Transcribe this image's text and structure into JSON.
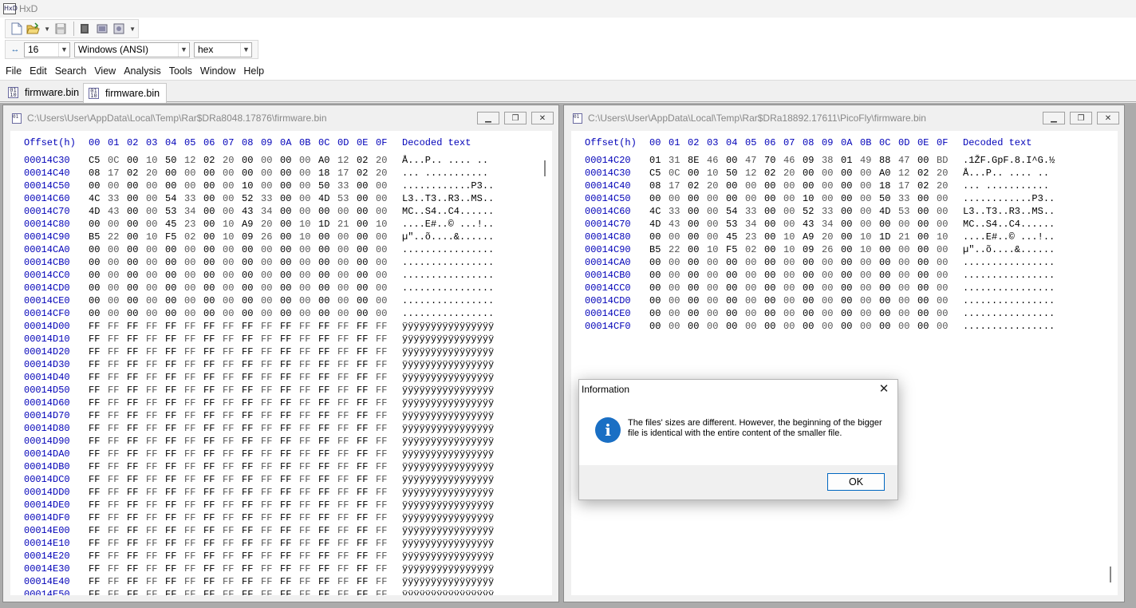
{
  "window": {
    "title": "HxD"
  },
  "toolbar": {
    "bytes_per_row": "16",
    "charset": "Windows (ANSI)",
    "offset_base": "hex"
  },
  "menu": [
    "File",
    "Edit",
    "Search",
    "View",
    "Analysis",
    "Tools",
    "Window",
    "Help"
  ],
  "tabs": [
    {
      "label": "firmware.bin",
      "active": false
    },
    {
      "label": "firmware.bin",
      "active": true
    }
  ],
  "hex_header": {
    "offset_label": "Offset(h)",
    "columns": [
      "00",
      "01",
      "02",
      "03",
      "04",
      "05",
      "06",
      "07",
      "08",
      "09",
      "0A",
      "0B",
      "0C",
      "0D",
      "0E",
      "0F"
    ],
    "text_label": "Decoded text"
  },
  "left_pane": {
    "path": "C:\\Users\\User\\AppData\\Local\\Temp\\Rar$DRa8048.17876\\firmware.bin",
    "rows": [
      {
        "off": "00014C30",
        "hex": "C5 0C 00 10 50 12 02 20 00 00 00 00 A0 12 02 20",
        "text": "Å...P.. .... .."
      },
      {
        "off": "00014C40",
        "hex": "08 17 02 20 00 00 00 00 00 00 00 00 18 17 02 20",
        "text": "... ........... "
      },
      {
        "off": "00014C50",
        "hex": "00 00 00 00 00 00 00 00 10 00 00 00 50 33 00 00",
        "text": "............P3.."
      },
      {
        "off": "00014C60",
        "hex": "4C 33 00 00 54 33 00 00 52 33 00 00 4D 53 00 00",
        "text": "L3..T3..R3..MS.."
      },
      {
        "off": "00014C70",
        "hex": "4D 43 00 00 53 34 00 00 43 34 00 00 00 00 00 00",
        "text": "MC..S4..C4......"
      },
      {
        "off": "00014C80",
        "hex": "00 00 00 00 45 23 00 10 A9 20 00 10 1D 21 00 10",
        "text": "....E#..© ...!.."
      },
      {
        "off": "00014C90",
        "hex": "B5 22 00 10 F5 02 00 10 09 26 00 10 00 00 00 00",
        "text": "µ\"..õ....&......"
      },
      {
        "off": "00014CA0",
        "hex": "00 00 00 00 00 00 00 00 00 00 00 00 00 00 00 00",
        "text": "................"
      },
      {
        "off": "00014CB0",
        "hex": "00 00 00 00 00 00 00 00 00 00 00 00 00 00 00 00",
        "text": "................"
      },
      {
        "off": "00014CC0",
        "hex": "00 00 00 00 00 00 00 00 00 00 00 00 00 00 00 00",
        "text": "................"
      },
      {
        "off": "00014CD0",
        "hex": "00 00 00 00 00 00 00 00 00 00 00 00 00 00 00 00",
        "text": "................"
      },
      {
        "off": "00014CE0",
        "hex": "00 00 00 00 00 00 00 00 00 00 00 00 00 00 00 00",
        "text": "................"
      },
      {
        "off": "00014CF0",
        "hex": "00 00 00 00 00 00 00 00 00 00 00 00 00 00 00 00",
        "text": "................"
      },
      {
        "off": "00014D00",
        "hex": "FF FF FF FF FF FF FF FF FF FF FF FF FF FF FF FF",
        "text": "ÿÿÿÿÿÿÿÿÿÿÿÿÿÿÿÿ"
      },
      {
        "off": "00014D10",
        "hex": "FF FF FF FF FF FF FF FF FF FF FF FF FF FF FF FF",
        "text": "ÿÿÿÿÿÿÿÿÿÿÿÿÿÿÿÿ"
      },
      {
        "off": "00014D20",
        "hex": "FF FF FF FF FF FF FF FF FF FF FF FF FF FF FF FF",
        "text": "ÿÿÿÿÿÿÿÿÿÿÿÿÿÿÿÿ"
      },
      {
        "off": "00014D30",
        "hex": "FF FF FF FF FF FF FF FF FF FF FF FF FF FF FF FF",
        "text": "ÿÿÿÿÿÿÿÿÿÿÿÿÿÿÿÿ"
      },
      {
        "off": "00014D40",
        "hex": "FF FF FF FF FF FF FF FF FF FF FF FF FF FF FF FF",
        "text": "ÿÿÿÿÿÿÿÿÿÿÿÿÿÿÿÿ"
      },
      {
        "off": "00014D50",
        "hex": "FF FF FF FF FF FF FF FF FF FF FF FF FF FF FF FF",
        "text": "ÿÿÿÿÿÿÿÿÿÿÿÿÿÿÿÿ"
      },
      {
        "off": "00014D60",
        "hex": "FF FF FF FF FF FF FF FF FF FF FF FF FF FF FF FF",
        "text": "ÿÿÿÿÿÿÿÿÿÿÿÿÿÿÿÿ"
      },
      {
        "off": "00014D70",
        "hex": "FF FF FF FF FF FF FF FF FF FF FF FF FF FF FF FF",
        "text": "ÿÿÿÿÿÿÿÿÿÿÿÿÿÿÿÿ"
      },
      {
        "off": "00014D80",
        "hex": "FF FF FF FF FF FF FF FF FF FF FF FF FF FF FF FF",
        "text": "ÿÿÿÿÿÿÿÿÿÿÿÿÿÿÿÿ"
      },
      {
        "off": "00014D90",
        "hex": "FF FF FF FF FF FF FF FF FF FF FF FF FF FF FF FF",
        "text": "ÿÿÿÿÿÿÿÿÿÿÿÿÿÿÿÿ"
      },
      {
        "off": "00014DA0",
        "hex": "FF FF FF FF FF FF FF FF FF FF FF FF FF FF FF FF",
        "text": "ÿÿÿÿÿÿÿÿÿÿÿÿÿÿÿÿ"
      },
      {
        "off": "00014DB0",
        "hex": "FF FF FF FF FF FF FF FF FF FF FF FF FF FF FF FF",
        "text": "ÿÿÿÿÿÿÿÿÿÿÿÿÿÿÿÿ"
      },
      {
        "off": "00014DC0",
        "hex": "FF FF FF FF FF FF FF FF FF FF FF FF FF FF FF FF",
        "text": "ÿÿÿÿÿÿÿÿÿÿÿÿÿÿÿÿ"
      },
      {
        "off": "00014DD0",
        "hex": "FF FF FF FF FF FF FF FF FF FF FF FF FF FF FF FF",
        "text": "ÿÿÿÿÿÿÿÿÿÿÿÿÿÿÿÿ"
      },
      {
        "off": "00014DE0",
        "hex": "FF FF FF FF FF FF FF FF FF FF FF FF FF FF FF FF",
        "text": "ÿÿÿÿÿÿÿÿÿÿÿÿÿÿÿÿ"
      },
      {
        "off": "00014DF0",
        "hex": "FF FF FF FF FF FF FF FF FF FF FF FF FF FF FF FF",
        "text": "ÿÿÿÿÿÿÿÿÿÿÿÿÿÿÿÿ"
      },
      {
        "off": "00014E00",
        "hex": "FF FF FF FF FF FF FF FF FF FF FF FF FF FF FF FF",
        "text": "ÿÿÿÿÿÿÿÿÿÿÿÿÿÿÿÿ"
      },
      {
        "off": "00014E10",
        "hex": "FF FF FF FF FF FF FF FF FF FF FF FF FF FF FF FF",
        "text": "ÿÿÿÿÿÿÿÿÿÿÿÿÿÿÿÿ"
      },
      {
        "off": "00014E20",
        "hex": "FF FF FF FF FF FF FF FF FF FF FF FF FF FF FF FF",
        "text": "ÿÿÿÿÿÿÿÿÿÿÿÿÿÿÿÿ"
      },
      {
        "off": "00014E30",
        "hex": "FF FF FF FF FF FF FF FF FF FF FF FF FF FF FF FF",
        "text": "ÿÿÿÿÿÿÿÿÿÿÿÿÿÿÿÿ"
      },
      {
        "off": "00014E40",
        "hex": "FF FF FF FF FF FF FF FF FF FF FF FF FF FF FF FF",
        "text": "ÿÿÿÿÿÿÿÿÿÿÿÿÿÿÿÿ"
      },
      {
        "off": "00014E50",
        "hex": "FF FF FF FF FF FF FF FF FF FF FF FF FF FF FF FF",
        "text": "ÿÿÿÿÿÿÿÿÿÿÿÿÿÿÿÿ"
      }
    ]
  },
  "right_pane": {
    "path": "C:\\Users\\User\\AppData\\Local\\Temp\\Rar$DRa18892.17611\\PicoFly\\firmware.bin",
    "rows": [
      {
        "off": "00014C20",
        "hex": "01 31 8E 46 00 47 70 46 09 38 01 49 88 47 00 BD",
        "text": ".1ŽF.GpF.8.I^G.½"
      },
      {
        "off": "00014C30",
        "hex": "C5 0C 00 10 50 12 02 20 00 00 00 00 A0 12 02 20",
        "text": "Å...P.. .... .."
      },
      {
        "off": "00014C40",
        "hex": "08 17 02 20 00 00 00 00 00 00 00 00 18 17 02 20",
        "text": "... ........... "
      },
      {
        "off": "00014C50",
        "hex": "00 00 00 00 00 00 00 00 10 00 00 00 50 33 00 00",
        "text": "............P3.."
      },
      {
        "off": "00014C60",
        "hex": "4C 33 00 00 54 33 00 00 52 33 00 00 4D 53 00 00",
        "text": "L3..T3..R3..MS.."
      },
      {
        "off": "00014C70",
        "hex": "4D 43 00 00 53 34 00 00 43 34 00 00 00 00 00 00",
        "text": "MC..S4..C4......"
      },
      {
        "off": "00014C80",
        "hex": "00 00 00 00 45 23 00 10 A9 20 00 10 1D 21 00 10",
        "text": "....E#..© ...!.."
      },
      {
        "off": "00014C90",
        "hex": "B5 22 00 10 F5 02 00 10 09 26 00 10 00 00 00 00",
        "text": "µ\"..õ....&......"
      },
      {
        "off": "00014CA0",
        "hex": "00 00 00 00 00 00 00 00 00 00 00 00 00 00 00 00",
        "text": "................"
      },
      {
        "off": "00014CB0",
        "hex": "00 00 00 00 00 00 00 00 00 00 00 00 00 00 00 00",
        "text": "................"
      },
      {
        "off": "00014CC0",
        "hex": "00 00 00 00 00 00 00 00 00 00 00 00 00 00 00 00",
        "text": "................"
      },
      {
        "off": "00014CD0",
        "hex": "00 00 00 00 00 00 00 00 00 00 00 00 00 00 00 00",
        "text": "................"
      },
      {
        "off": "00014CE0",
        "hex": "00 00 00 00 00 00 00 00 00 00 00 00 00 00 00 00",
        "text": "................"
      },
      {
        "off": "00014CF0",
        "hex": "00 00 00 00 00 00 00 00 00 00 00 00 00 00 00 00",
        "text": "................"
      }
    ]
  },
  "dialog": {
    "title": "Information",
    "message": "The files' sizes are different. However, the beginning of the bigger file is identical with the entire content of the smaller file.",
    "ok_label": "OK"
  }
}
